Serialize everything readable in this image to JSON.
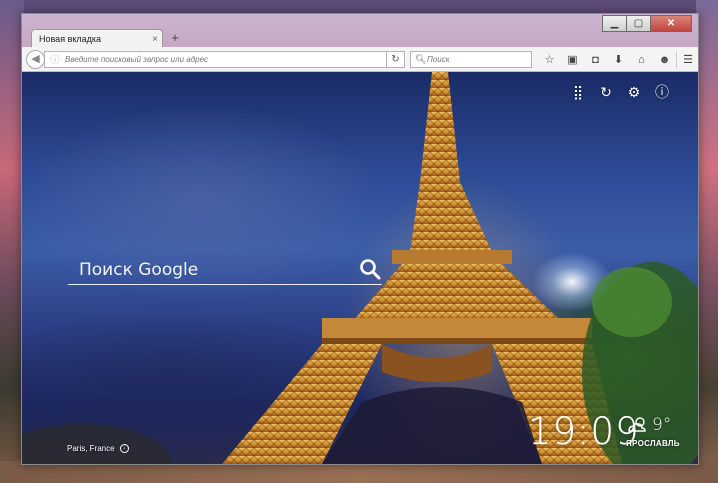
{
  "window": {
    "minimize_icon": "minimize-icon",
    "maximize_icon": "maximize-icon",
    "close_icon": "close-icon"
  },
  "tabs": [
    {
      "label": "Новая вкладка",
      "active": true
    }
  ],
  "new_tab_label": "+",
  "navbar": {
    "url_placeholder": "Введите поисковый запрос или адрес",
    "search_placeholder": "Поиск",
    "toolbar_icons": [
      "bookmark-star-icon",
      "reading-list-icon",
      "pocket-icon",
      "download-icon",
      "home-icon",
      "chat-icon",
      "menu-icon"
    ]
  },
  "dashboard": {
    "icons": [
      "apps-grid-icon",
      "refresh-icon",
      "settings-icon",
      "info-icon"
    ],
    "search_placeholder": "Поиск Google",
    "location": "Paris, France",
    "time": "19:09",
    "weather": {
      "temperature": "9°",
      "city": "ЯРОСЛАВЛЬ",
      "icon": "partly-cloudy-icon"
    }
  },
  "colors": {
    "titlebar": "#c7a7c3",
    "sky_top": "#1a2b66",
    "tower_gold": "#e8a640"
  }
}
